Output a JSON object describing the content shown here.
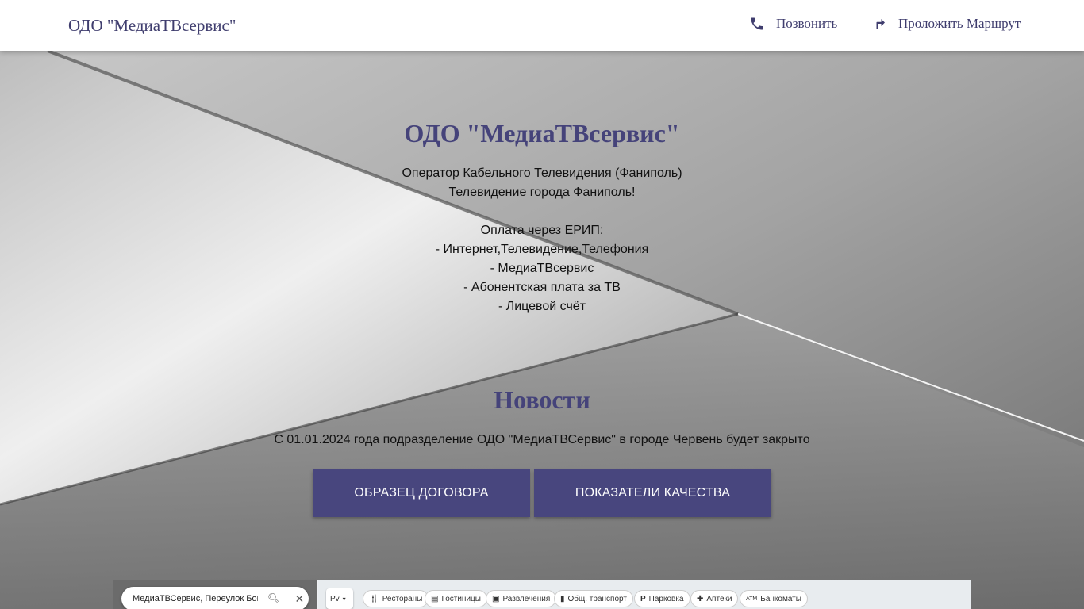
{
  "header": {
    "brand": "ОДО \"МедиаТВсервис\"",
    "call_label": "Позвонить",
    "route_label": "Проложить Маршрут"
  },
  "hero": {
    "title": "ОДО \"МедиаТВсервис\"",
    "lines": [
      "Оператор Кабельного Телевидения (Фаниполь)",
      "Телевидение города Фаниполь!",
      "",
      "Оплата через ЕРИП:",
      "- Интернет,Телевидение,Телефония",
      "- МедиаТВсервис",
      "- Абонентская плата за ТВ",
      "- Лицевой счёт"
    ]
  },
  "news": {
    "title": "Новости",
    "text": "С 01.01.2024 года подразделение ОДО \"МедиаТВСервис\" в городе Червень будет закрыто"
  },
  "buttons": {
    "contract": "ОБРАЗЕЦ ДОГОВОРА",
    "quality": "ПОКАЗАТЕЛИ КАЧЕСТВА"
  },
  "map": {
    "search_value": "МедиаТВСервис, Переулок Богдан",
    "layer_label": "Рv",
    "chips": [
      {
        "icon": "restaurant-icon",
        "label": "Рестораны"
      },
      {
        "icon": "hotel-icon",
        "label": "Гостиницы"
      },
      {
        "icon": "entertainment-icon",
        "label": "Развлечения"
      },
      {
        "icon": "transit-icon",
        "label": "Общ. транспорт"
      },
      {
        "icon": "parking-icon",
        "label": "Парковка"
      },
      {
        "icon": "pharmacy-icon",
        "label": "Аптеки"
      },
      {
        "icon": "atm-icon",
        "label": "Банкоматы"
      }
    ]
  },
  "colors": {
    "accent": "#48467e",
    "title": "#45437a",
    "header_bg": "#ffffff"
  }
}
